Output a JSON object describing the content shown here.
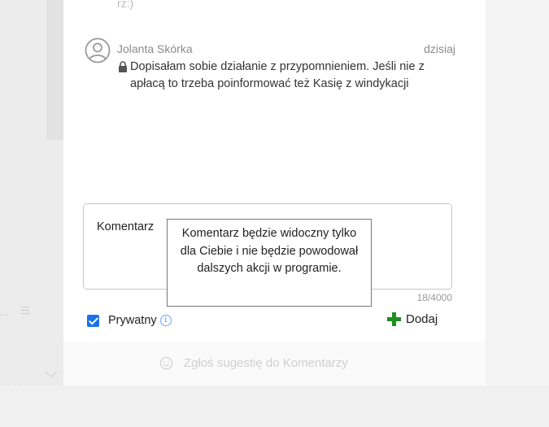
{
  "previous_comment": {
    "tail_text": "rz:)"
  },
  "comment": {
    "author": "Jolanta Skórka",
    "date": "dzisiaj",
    "text": "Dopisałam sobie działanie z przypomnieniem. Jeśli nie zapłacą to trzeba poinformować też Kasię z windykacji",
    "private": true,
    "avatar_icon": "user-circle-icon",
    "lock_icon": "lock-icon"
  },
  "composer": {
    "placeholder": "Komentarz",
    "counter": "18/4000",
    "tooltip": "Komentarz będzie widoczny tylko dla Ciebie i nie będzie powodował dalszych akcji w programie.",
    "private_label": "Prywatny",
    "private_checked": true,
    "add_label": "Dodaj",
    "colors": {
      "checkbox": "#1a73e8",
      "add_icon": "#1f8f1f",
      "info_icon": "#3d8bff"
    }
  },
  "suggest": {
    "label": "Zgłoś sugestię do Komentarzy",
    "icon": "smile-icon"
  },
  "background": {
    "ellipsis": "...",
    "dots": "..."
  }
}
